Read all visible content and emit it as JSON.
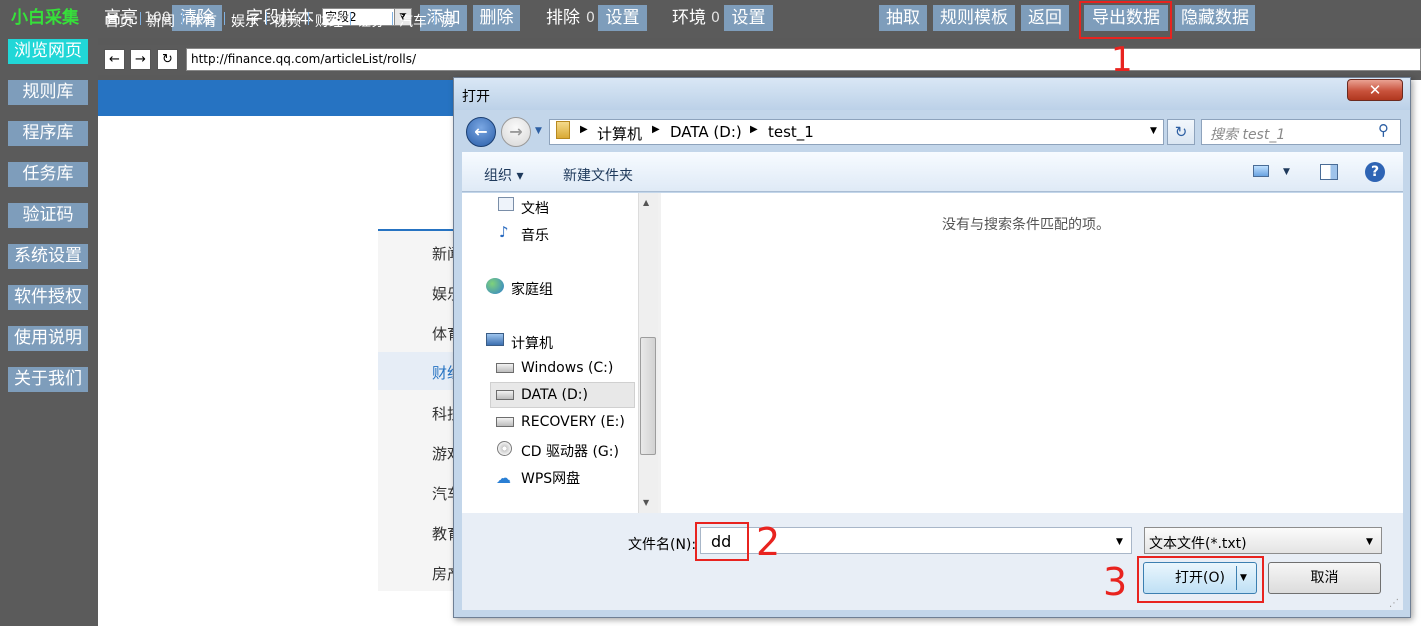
{
  "toolbar": {
    "app_name": "小白采集",
    "highlight_label": "高亮",
    "highlight_count": "100",
    "clear_label": "清除",
    "field_sample_label": "字段样本",
    "field_select_value": "字段2",
    "add_label": "添加",
    "delete_label": "删除",
    "exclude_label": "排除",
    "exclude_count": "0",
    "exclude_set_label": "设置",
    "env_label": "环境",
    "env_count": "0",
    "env_set_label": "设置",
    "extract_label": "抽取",
    "rule_template_label": "规则模板",
    "back_label": "返回",
    "export_label": "导出数据",
    "hide_label": "隐藏数据"
  },
  "sidebar": {
    "items": [
      {
        "label": "浏览网页",
        "active": true
      },
      {
        "label": "规则库"
      },
      {
        "label": "程序库"
      },
      {
        "label": "任务库"
      },
      {
        "label": "验证码"
      },
      {
        "label": "系统设置"
      },
      {
        "label": "软件授权"
      },
      {
        "label": "使用说明"
      },
      {
        "label": "关于我们"
      }
    ]
  },
  "browser": {
    "back_glyph": "←",
    "forward_glyph": "→",
    "refresh_glyph": "↻",
    "url": "http://finance.qq.com/articleList/rolls/",
    "site_nav": [
      "首页",
      "新闻",
      "体育",
      "娱乐",
      "视频",
      "财经",
      "证券",
      "汽车",
      "房"
    ],
    "side_menu": [
      "新闻",
      "娱乐",
      "体育",
      "财经",
      "科技",
      "游戏",
      "汽车",
      "教育",
      "房产"
    ]
  },
  "dialog": {
    "title": "打开",
    "close_glyph": "✕",
    "back_glyph": "←",
    "forward_glyph": "→",
    "breadcrumb": [
      "计算机",
      "DATA (D:)",
      "test_1"
    ],
    "refresh_glyph": "↻",
    "search_placeholder": "搜索 test_1",
    "search_glyph": "⚲",
    "organize_label": "组织 ▾",
    "new_folder_label": "新建文件夹",
    "help_glyph": "?",
    "nav_tree": [
      "文档",
      "音乐",
      "家庭组",
      "计算机",
      "Windows (C:)",
      "DATA (D:)",
      "RECOVERY (E:)",
      "CD 驱动器 (G:)",
      "WPS网盘"
    ],
    "empty_message": "没有与搜索条件匹配的项。",
    "filename_label": "文件名(N):",
    "filename_value": "dd",
    "filetype_value": "文本文件(*.txt)",
    "open_label": "打开(O)",
    "cancel_label": "取消"
  },
  "annotations": [
    "1",
    "2",
    "3"
  ],
  "colors": {
    "accent_button": "#7e9dbb",
    "active_sidebar": "#21d7d7",
    "annotation_red": "#e8231f",
    "site_nav_blue": "#2673c2"
  }
}
